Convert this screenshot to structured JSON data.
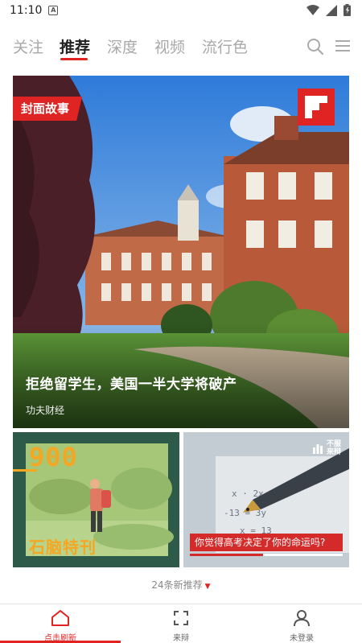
{
  "status_bar": {
    "time": "11:10",
    "notification_icon": "A"
  },
  "tabs": [
    {
      "label": "关注"
    },
    {
      "label": "推荐",
      "active": true
    },
    {
      "label": "深度"
    },
    {
      "label": "视频"
    },
    {
      "label": "流行色"
    }
  ],
  "hero": {
    "badge": "封面故事",
    "title": "拒绝留学生，美国一半大学将破产",
    "source": "功夫财经",
    "logo_color": "#e02424"
  },
  "cards": [
    {
      "number": "900",
      "series": "石脑特刊",
      "bg_color": "#2d5a49",
      "accent_color": "#f5a623"
    },
    {
      "badge_line1": "不服",
      "badge_line2": "来辩",
      "question": "你觉得高考决定了你的命运吗?",
      "progress": 0.48
    }
  ],
  "refresh_hint": "24条新推荐",
  "bottom_nav": [
    {
      "label": "点击刷新",
      "icon": "home-icon",
      "active": true
    },
    {
      "label": "来辩",
      "icon": "debate-icon"
    },
    {
      "label": "未登录",
      "icon": "user-icon"
    }
  ],
  "colors": {
    "accent": "#e02424",
    "tab_inactive": "#a8a8a8"
  }
}
